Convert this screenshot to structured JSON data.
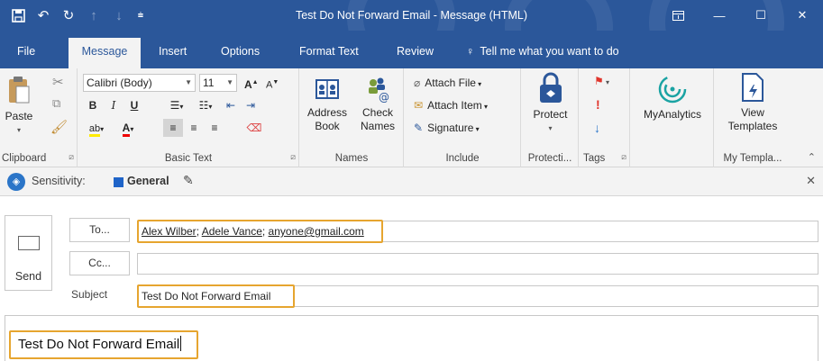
{
  "window": {
    "title": "Test Do Not Forward Email  -  Message (HTML)"
  },
  "tabs": [
    "File",
    "Message",
    "Insert",
    "Options",
    "Format Text",
    "Review",
    "Tell me what you want to do"
  ],
  "ribbon": {
    "clipboard": {
      "paste": "Paste",
      "label": "Clipboard"
    },
    "basic_text": {
      "font": "Calibri (Body)",
      "size": "11",
      "bold": "B",
      "italic": "I",
      "underline": "U",
      "label": "Basic Text"
    },
    "names": {
      "address_book": [
        "Address",
        "Book"
      ],
      "check_names": [
        "Check",
        "Names"
      ],
      "label": "Names"
    },
    "include": {
      "attach_file": "Attach File",
      "attach_item": "Attach Item",
      "signature": "Signature",
      "label": "Include"
    },
    "protection": {
      "protect": "Protect",
      "label": "Protecti..."
    },
    "tags": {
      "label": "Tags"
    },
    "myanalytics": {
      "button": "MyAnalytics"
    },
    "templates": {
      "view": [
        "View",
        "Templates"
      ],
      "label": "My Templa..."
    }
  },
  "sensitivity": {
    "label": "Sensitivity:",
    "value": "General"
  },
  "compose": {
    "send": "Send",
    "to_button": "To...",
    "cc_button": "Cc...",
    "subject_label": "Subject",
    "recipients": [
      "Alex Wilber",
      "Adele Vance",
      "anyone@gmail.com"
    ],
    "cc_value": "",
    "subject_value": "Test Do Not Forward Email",
    "body_text": "Test Do Not Forward Email"
  },
  "colors": {
    "accent": "#2b579a",
    "highlight": "#e6a52f",
    "sensitivity_square": "#1f64c8"
  }
}
